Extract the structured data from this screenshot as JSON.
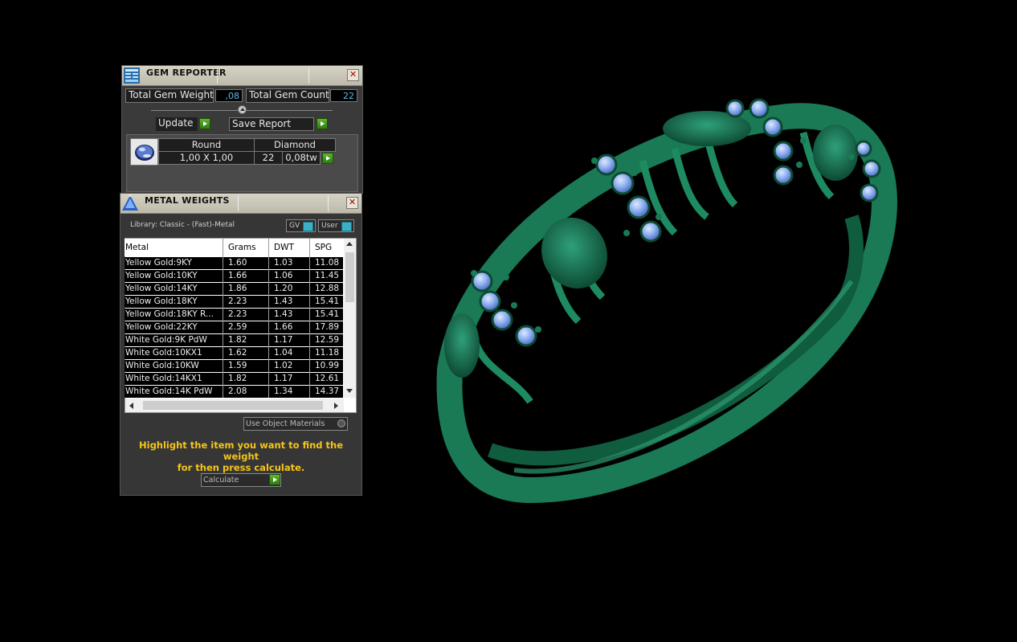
{
  "gem_reporter": {
    "title": "GEM REPORTER",
    "total_gem_weight_label": "Total Gem Weight",
    "total_gem_weight_value": ",08",
    "total_gem_count_label": "Total Gem Count",
    "total_gem_count_value": "22",
    "update_label": "Update",
    "save_report_label": "Save Report",
    "gem_row": {
      "shape": "Round",
      "type": "Diamond",
      "size": "1,00 X 1,00",
      "count": "22",
      "weight": "0,08tw"
    }
  },
  "metal_weights": {
    "title": "METAL WEIGHTS",
    "library_label": "Library: Classic - (Fast)-Metal",
    "gv_label": "GV",
    "user_label": "User",
    "columns": [
      "Metal",
      "Grams",
      "DWT",
      "SPG"
    ],
    "rows": [
      [
        "Yellow Gold:9KY",
        "1.60",
        "1.03",
        "11.08"
      ],
      [
        "Yellow Gold:10KY",
        "1.66",
        "1.06",
        "11.45"
      ],
      [
        "Yellow Gold:14KY",
        "1.86",
        "1.20",
        "12.88"
      ],
      [
        "Yellow Gold:18KY",
        "2.23",
        "1.43",
        "15.41"
      ],
      [
        "Yellow Gold:18KY R...",
        "2.23",
        "1.43",
        "15.41"
      ],
      [
        "Yellow Gold:22KY",
        "2.59",
        "1.66",
        "17.89"
      ],
      [
        "White Gold:9K PdW",
        "1.82",
        "1.17",
        "12.59"
      ],
      [
        "White Gold:10KX1",
        "1.62",
        "1.04",
        "11.18"
      ],
      [
        "White Gold:10KW",
        "1.59",
        "1.02",
        "10.99"
      ],
      [
        "White Gold:14KX1",
        "1.82",
        "1.17",
        "12.61"
      ],
      [
        "White Gold:14K PdW",
        "2.08",
        "1.34",
        "14.37"
      ]
    ],
    "use_object_materials_label": "Use Object Materials",
    "hint_line1": "Highlight the item you want to find the weight",
    "hint_line2": "for then press calculate.",
    "calculate_label": "Calculate"
  },
  "colors": {
    "ring_green": "#1a7a55",
    "gem_blue": "#8fb0f0",
    "hint_yellow": "#f5c518",
    "button_green": "#3f9a1f"
  }
}
